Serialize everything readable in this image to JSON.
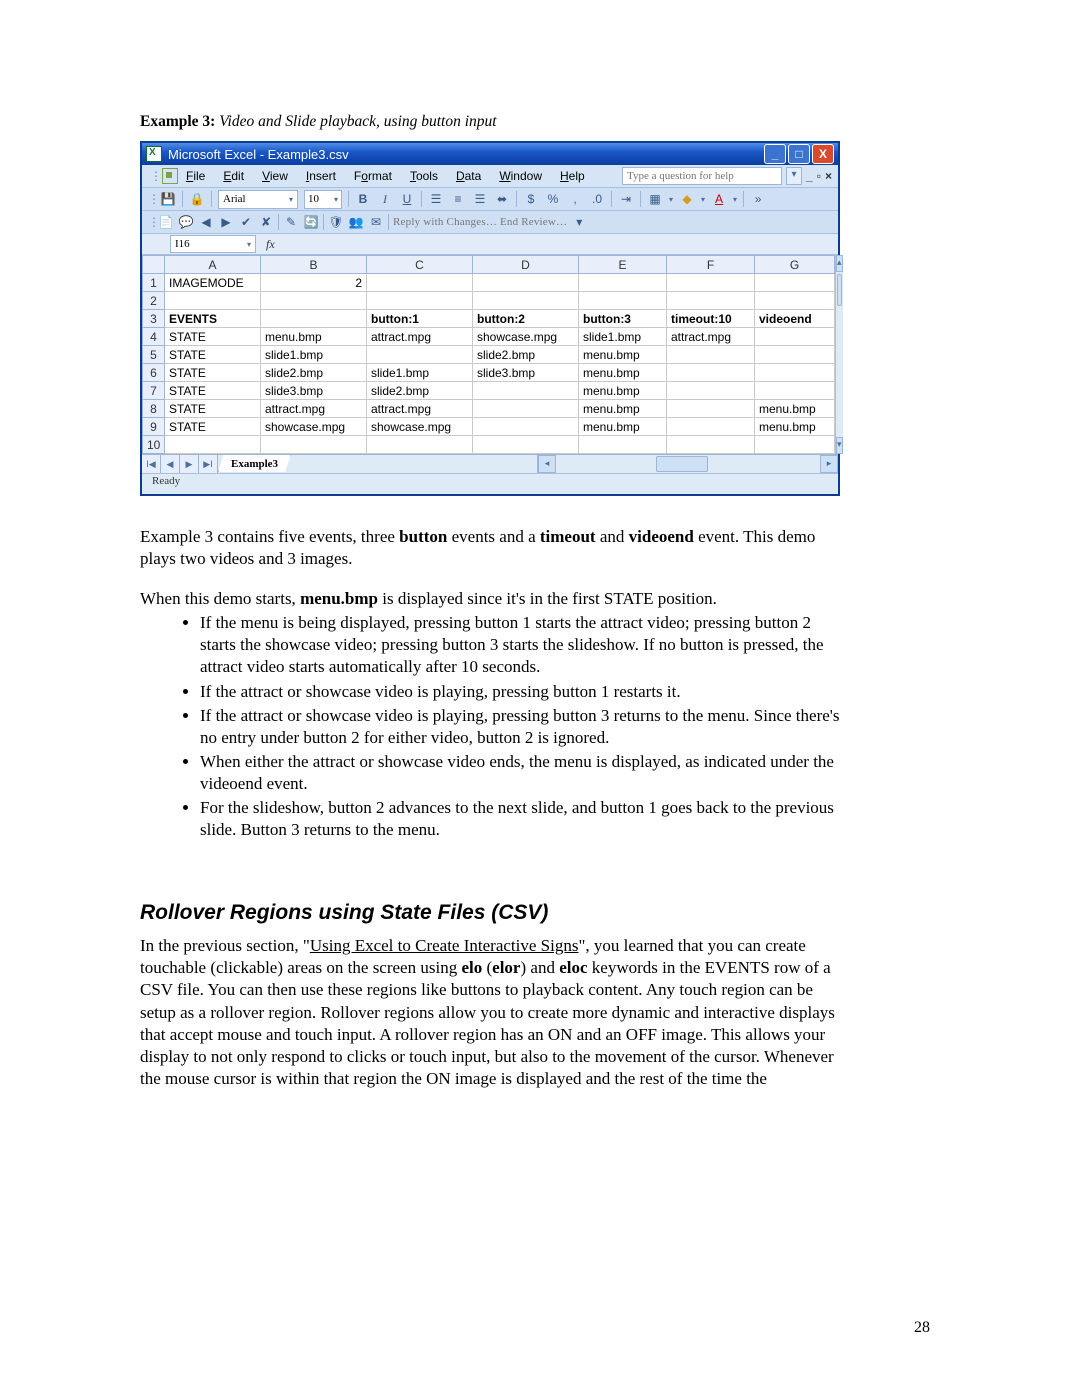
{
  "caption": {
    "label": "Example 3:",
    "desc": "Video and Slide playback, using button input"
  },
  "excel": {
    "title": "Microsoft Excel - Example3.csv",
    "menus": [
      "File",
      "Edit",
      "View",
      "Insert",
      "Format",
      "Tools",
      "Data",
      "Window",
      "Help"
    ],
    "help_placeholder": "Type a question for help",
    "font_name": "Arial",
    "font_size": "10",
    "toolbar2": "Reply with Changes…  End Review…",
    "namebox": "I16",
    "fx_label": "fx",
    "cols": [
      "",
      "A",
      "B",
      "C",
      "D",
      "E",
      "F",
      "G"
    ],
    "rows": [
      {
        "n": "1",
        "c": [
          "IMAGEMODE",
          "2",
          "",
          "",
          "",
          "",
          ""
        ]
      },
      {
        "n": "2",
        "c": [
          "",
          "",
          "",
          "",
          "",
          "",
          ""
        ]
      },
      {
        "n": "3",
        "bold": true,
        "c": [
          "EVENTS",
          "",
          "button:1",
          "button:2",
          "button:3",
          "timeout:10",
          "videoend"
        ]
      },
      {
        "n": "4",
        "c": [
          "STATE",
          "menu.bmp",
          "attract.mpg",
          "showcase.mpg",
          "slide1.bmp",
          "attract.mpg",
          ""
        ]
      },
      {
        "n": "5",
        "c": [
          "STATE",
          "slide1.bmp",
          "",
          "slide2.bmp",
          "menu.bmp",
          "",
          ""
        ]
      },
      {
        "n": "6",
        "c": [
          "STATE",
          "slide2.bmp",
          "slide1.bmp",
          "slide3.bmp",
          "menu.bmp",
          "",
          ""
        ]
      },
      {
        "n": "7",
        "c": [
          "STATE",
          "slide3.bmp",
          "slide2.bmp",
          "",
          "menu.bmp",
          "",
          ""
        ]
      },
      {
        "n": "8",
        "c": [
          "STATE",
          "attract.mpg",
          "attract.mpg",
          "",
          "menu.bmp",
          "",
          "menu.bmp"
        ]
      },
      {
        "n": "9",
        "c": [
          "STATE",
          "showcase.mpg",
          "showcase.mpg",
          "",
          "menu.bmp",
          "",
          "menu.bmp"
        ]
      },
      {
        "n": "10",
        "c": [
          "",
          "",
          "",
          "",
          "",
          "",
          ""
        ]
      }
    ],
    "sheet_tab": "Example3",
    "status": "Ready"
  },
  "para1": {
    "a": "Example 3 contains five events, three ",
    "b": "button",
    "c": " events and a ",
    "d": "timeout",
    "e": " and ",
    "f": "videoend",
    "g": " event. This demo plays two videos and 3 images."
  },
  "para2": {
    "a": "When this demo starts, ",
    "b": "menu.bmp",
    "c": " is displayed since it's in the first STATE position."
  },
  "bullets": [
    "If the menu is being displayed, pressing button 1 starts the attract video; pressing button 2 starts the showcase video; pressing button 3 starts the slideshow.  If no button is pressed, the attract video starts automatically after 10 seconds.",
    "If the attract or showcase video is playing, pressing button 1 restarts it.",
    "If the attract or showcase video is playing, pressing button 3 returns to the menu. Since there's no entry under button 2 for either video, button 2 is ignored.",
    "When either the attract or showcase video ends, the menu is displayed, as indicated under the videoend event.",
    "For the slideshow, button 2 advances to the next slide, and button 1 goes back to the previous slide. Button 3 returns to the menu."
  ],
  "section_heading": "Rollover Regions using State Files (CSV)",
  "para3": {
    "a": "In the previous section, \"",
    "u": "Using Excel to Create Interactive Signs",
    "b": "\", you learned that you can create touchable (clickable) areas on the screen using ",
    "k1": "elo",
    "c": " (",
    "k2": "elor",
    "d": ") and ",
    "k3": "eloc",
    "e": " keywords in the EVENTS row of a CSV file. You can then use these regions like buttons to playback content. Any touch region can be setup as a rollover region. Rollover regions allow you to create more dynamic and interactive displays that accept mouse and touch input. A rollover region has an ON and an OFF image. This allows your display to not only respond to clicks or touch input, but also to the movement of the cursor. Whenever the mouse cursor is within that region the ON image is displayed and the rest of the time the"
  },
  "page_number": "28",
  "win_btns": {
    "min": "_",
    "max": "□",
    "close": "X"
  }
}
